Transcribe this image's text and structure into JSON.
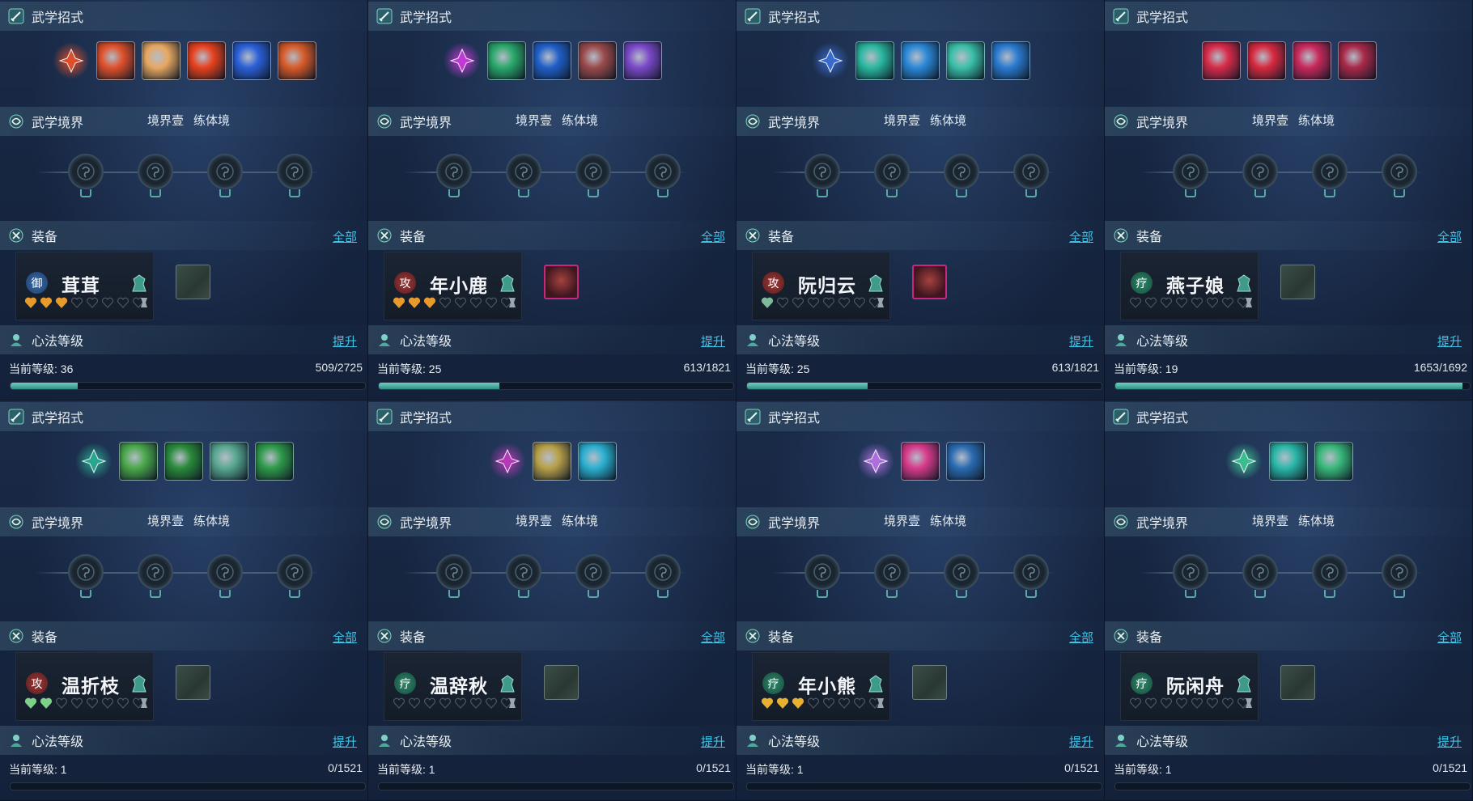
{
  "panels": [
    {
      "skills_title": "武学招式",
      "realm_title": "武学境界",
      "realm_stage": "境界壹",
      "realm_name": "练体境",
      "equip_title": "装备",
      "equip_all": "全部",
      "character": {
        "badge": "御",
        "badge_type": "yu",
        "name": "茸茸",
        "stars_filled": 3,
        "star_color": "#e89a2c"
      },
      "equip_item": false,
      "heart_title": "心法等级",
      "heart_upgrade": "提升",
      "level_text": "当前等级: 36",
      "exp_text": "509/2725",
      "progress": 0.19,
      "skill_colors": [
        "#e0502a",
        "#e8a860",
        "#e8401c",
        "#2a5fd8",
        "#d85a28"
      ],
      "main_skill_color": "#e0502a"
    },
    {
      "skills_title": "武学招式",
      "realm_title": "武学境界",
      "realm_stage": "境界壹",
      "realm_name": "练体境",
      "equip_title": "装备",
      "equip_all": "全部",
      "character": {
        "badge": "攻",
        "badge_type": "gong",
        "name": "年小鹿",
        "stars_filled": 3,
        "star_color": "#e89a2c"
      },
      "equip_item": true,
      "heart_title": "心法等级",
      "heart_upgrade": "提升",
      "level_text": "当前等级: 25",
      "exp_text": "613/1821",
      "progress": 0.34,
      "skill_colors": [
        "#2aa86a",
        "#1f5fc8",
        "#9a4a4a",
        "#7a48c8"
      ],
      "main_skill_color": "#c43ad8"
    },
    {
      "skills_title": "武学招式",
      "realm_title": "武学境界",
      "realm_stage": "境界壹",
      "realm_name": "练体境",
      "equip_title": "装备",
      "equip_all": "全部",
      "character": {
        "badge": "攻",
        "badge_type": "gong",
        "name": "阮归云",
        "stars_filled": 1,
        "star_color": "#7fb89a"
      },
      "equip_item": true,
      "heart_title": "心法等级",
      "heart_upgrade": "提升",
      "level_text": "当前等级: 25",
      "exp_text": "613/1821",
      "progress": 0.34,
      "skill_colors": [
        "#2ab8a0",
        "#2a88d8",
        "#3ac0a8",
        "#2a7ad0"
      ],
      "main_skill_color": "#3a6cd0"
    },
    {
      "skills_title": "武学招式",
      "realm_title": "武学境界",
      "realm_stage": "境界壹",
      "realm_name": "练体境",
      "equip_title": "装备",
      "equip_all": "全部",
      "character": {
        "badge": "疗",
        "badge_type": "liao",
        "name": "燕子娘",
        "stars_filled": 0,
        "star_color": "#7fb89a"
      },
      "equip_item": false,
      "heart_title": "心法等级",
      "heart_upgrade": "提升",
      "level_text": "当前等级: 19",
      "exp_text": "1653/1692",
      "progress": 0.98,
      "skill_colors": [
        "#d82a48",
        "#d8283e",
        "#c8285a",
        "#a82848"
      ],
      "main_skill_color": null
    },
    {
      "skills_title": "武学招式",
      "realm_title": "武学境界",
      "realm_stage": "境界壹",
      "realm_name": "练体境",
      "equip_title": "装备",
      "equip_all": "全部",
      "character": {
        "badge": "攻",
        "badge_type": "gong",
        "name": "温折枝",
        "stars_filled": 2,
        "star_color": "#7fd08a"
      },
      "equip_item": false,
      "heart_title": "心法等级",
      "heart_upgrade": "提升",
      "level_text": "当前等级: 1",
      "exp_text": "0/1521",
      "progress": 0.0,
      "skill_colors": [
        "#4aa84a",
        "#2a8a3a",
        "#58a890",
        "#2e9a48"
      ],
      "main_skill_color": "#2aa890"
    },
    {
      "skills_title": "武学招式",
      "realm_title": "武学境界",
      "realm_stage": "境界壹",
      "realm_name": "练体境",
      "equip_title": "装备",
      "equip_all": "全部",
      "character": {
        "badge": "疗",
        "badge_type": "liao",
        "name": "温辞秋",
        "stars_filled": 0,
        "star_color": "#7fb89a"
      },
      "equip_item": false,
      "heart_title": "心法等级",
      "heart_upgrade": "提升",
      "level_text": "当前等级: 1",
      "exp_text": "0/1521",
      "progress": 0.0,
      "skill_colors": [
        "#b8a048",
        "#2ab0d0"
      ],
      "main_skill_color": "#b83ab8"
    },
    {
      "skills_title": "武学招式",
      "realm_title": "武学境界",
      "realm_stage": "境界壹",
      "realm_name": "练体境",
      "equip_title": "装备",
      "equip_all": "全部",
      "character": {
        "badge": "疗",
        "badge_type": "liao",
        "name": "年小熊",
        "stars_filled": 3,
        "star_color": "#e8b030"
      },
      "equip_item": false,
      "heart_title": "心法等级",
      "heart_upgrade": "提升",
      "level_text": "当前等级: 1",
      "exp_text": "0/1521",
      "progress": 0.0,
      "skill_colors": [
        "#d83a8a",
        "#2a6ab0"
      ],
      "main_skill_color": "#b070e0"
    },
    {
      "skills_title": "武学招式",
      "realm_title": "武学境界",
      "realm_stage": "境界壹",
      "realm_name": "练体境",
      "equip_title": "装备",
      "equip_all": "全部",
      "character": {
        "badge": "疗",
        "badge_type": "liao",
        "name": "阮闲舟",
        "stars_filled": 0,
        "star_color": "#7fb89a"
      },
      "equip_item": false,
      "heart_title": "心法等级",
      "heart_upgrade": "提升",
      "level_text": "当前等级: 1",
      "exp_text": "0/1521",
      "progress": 0.0,
      "skill_colors": [
        "#2ab8a8",
        "#38b87a"
      ],
      "main_skill_color": "#3ac090"
    }
  ],
  "colors": {
    "accent_link": "#3fc3e6",
    "progress_fill": "#4fb7a8",
    "background": "#16243f"
  }
}
